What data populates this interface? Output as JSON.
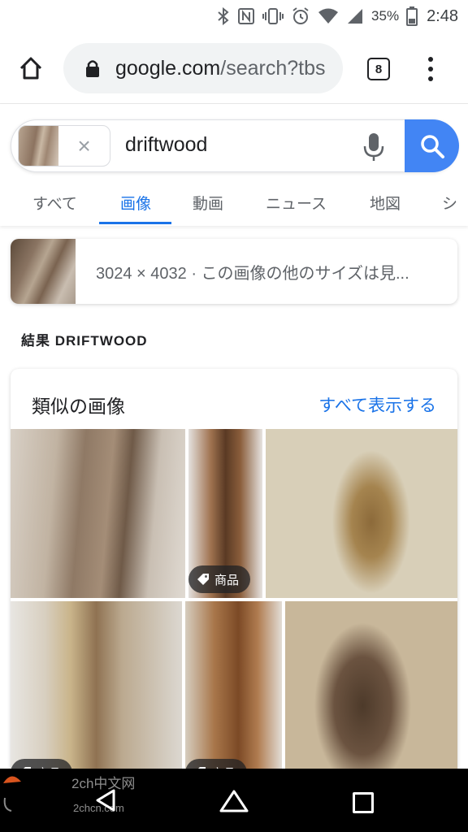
{
  "status_bar": {
    "battery_percent": "35%",
    "time": "2:48",
    "icons": [
      "bluetooth-icon",
      "nfc-icon",
      "vibrate-icon",
      "alarm-icon",
      "wifi-icon",
      "signal-icon",
      "battery-icon"
    ]
  },
  "browser": {
    "url_domain": "google.com",
    "url_path": "/search?tbs",
    "tab_count": "8"
  },
  "search": {
    "query": "driftwood",
    "tabs": [
      {
        "label": "すべて"
      },
      {
        "label": "画像"
      },
      {
        "label": "動画"
      },
      {
        "label": "ニュース"
      },
      {
        "label": "地図"
      },
      {
        "label": "シ"
      }
    ],
    "active_tab": "画像"
  },
  "image_info": {
    "text": "3024 × 4032 · この画像の他のサイズは見..."
  },
  "results": {
    "label": "結果 DRIFTWOOD"
  },
  "similar": {
    "title": "類似の画像",
    "see_all": "すべて表示する",
    "product_label": "商品"
  },
  "watermark": {
    "line1": "2ch中文网",
    "line2": "2chcn.com"
  },
  "colors": {
    "accent": "#1a73e8",
    "search_button": "#4285f4"
  }
}
